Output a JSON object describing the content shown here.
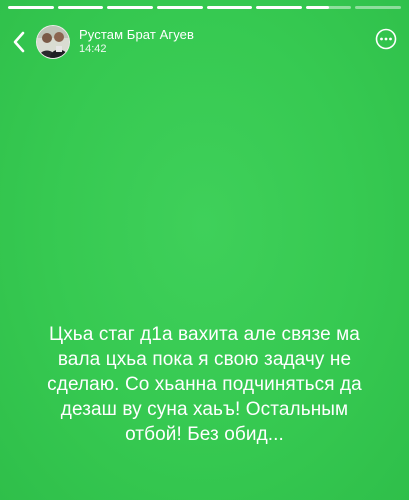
{
  "story": {
    "progress_segments": [
      1,
      1,
      1,
      1,
      1,
      1,
      0.5,
      0
    ],
    "background_color": "#36c951"
  },
  "header": {
    "back_icon": "chevron-left-icon",
    "username": "Рустам Брат Агуев",
    "time": "14:42",
    "more_icon": "more-circle-icon"
  },
  "caption": {
    "lines": [
      "Цхьа стаг д1а вахита але связе ма",
      "вала цхьа пока я свою задачу не",
      "сделаю. Со хьанна подчиняться да",
      "дезаш ву суна хаьъ! Остальным",
      "отбой! Без обид..."
    ]
  }
}
